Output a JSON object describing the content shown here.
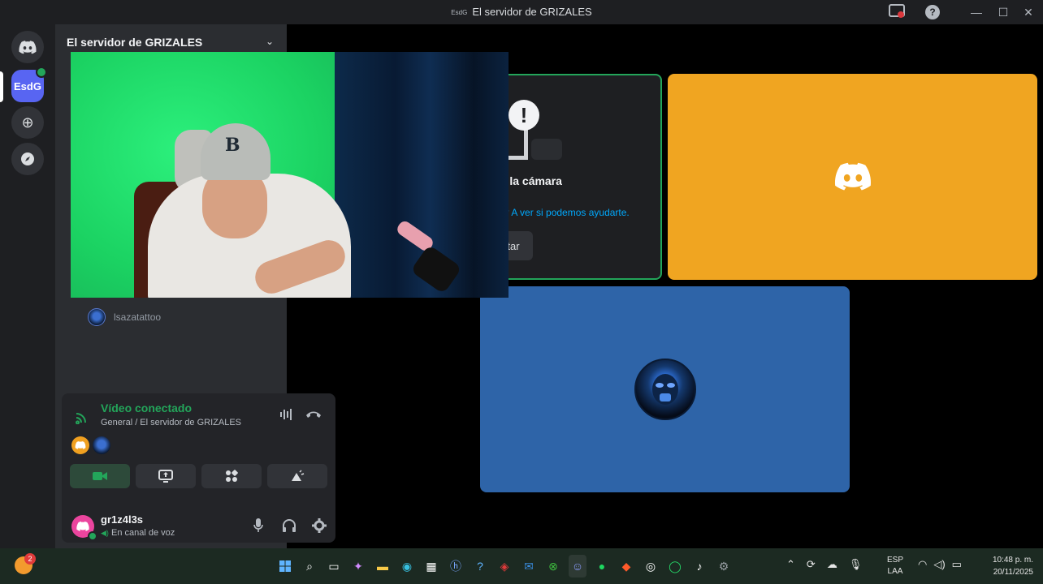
{
  "window": {
    "title": "El servidor de GRIZALES",
    "title_prefix": "EsdG"
  },
  "rail": {
    "active_server": "EsdG"
  },
  "sidebar": {
    "server_name": "El servidor de GRIZALES",
    "voice_members": [
      {
        "name": "lsazatattoo"
      }
    ]
  },
  "rtc": {
    "status": "Vídeo conectado",
    "channel": "General / El servidor de GRIZALES"
  },
  "user": {
    "username": "gr1z4l3s",
    "status": "En canal de voz"
  },
  "tiles": {
    "error_title": "r la cámara",
    "error_help": "? A ver si podemos ayudarte.",
    "error_button": "tar"
  },
  "taskbar": {
    "weather_badge": "2",
    "lang_line1": "ESP",
    "lang_line2": "LAA",
    "time": "10:48 p. m.",
    "date": "20/11/2025"
  },
  "colors": {
    "green": "#23a55a",
    "blurple": "#5865f2",
    "tile_orange": "#f0a521",
    "tile_blue": "#2e64a8",
    "link": "#00a8fc"
  }
}
